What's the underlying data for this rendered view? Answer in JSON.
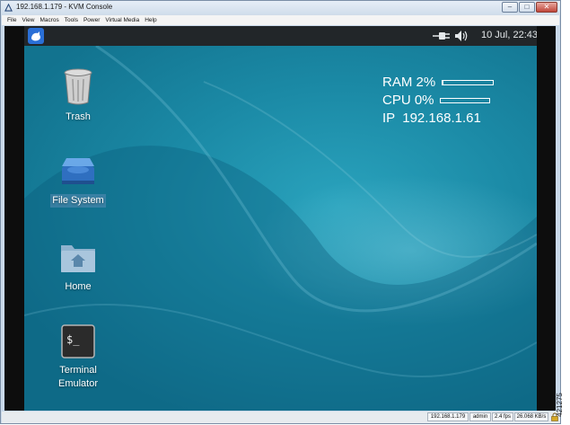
{
  "window": {
    "title": "192.168.1.179 - KVM Console",
    "menu": [
      "File",
      "View",
      "Macros",
      "Tools",
      "Power",
      "Virtual Media",
      "Help"
    ]
  },
  "panel": {
    "date_time": "10 Jul, 22:43"
  },
  "desktop_icons": [
    {
      "label": "Trash",
      "icon": "trash-icon"
    },
    {
      "label": "File System",
      "icon": "drive-icon"
    },
    {
      "label": "Home",
      "icon": "home-folder-icon"
    },
    {
      "label_line1": "Terminal",
      "label_line2": "Emulator",
      "icon": "terminal-icon"
    }
  ],
  "stats": {
    "ram_label": "RAM 2%",
    "cpu_label": "CPU 0%",
    "ip_label": "IP  192.168.1.61",
    "ram_percent": 2,
    "cpu_percent": 0
  },
  "statusbar": {
    "host": "192.168.1.179",
    "user": "admin",
    "fps": "2.4 fps",
    "rate": "26.068 KB/s"
  },
  "side_number": "421275",
  "colors": {
    "desktop": "#1b8aa6",
    "panel": "#222629",
    "title_bar": "#cfdcea"
  }
}
